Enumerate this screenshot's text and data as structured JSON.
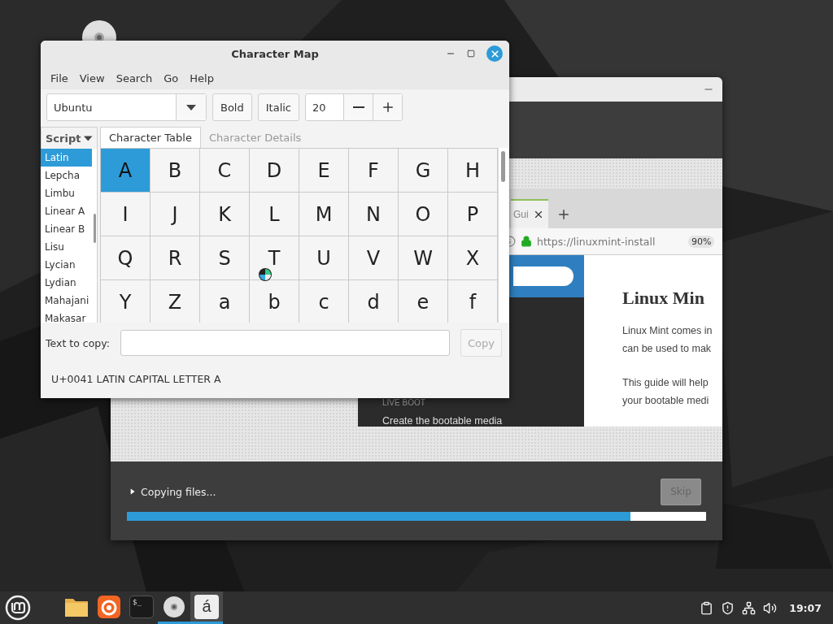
{
  "charmap": {
    "title": "Character Map",
    "menu": [
      "File",
      "View",
      "Search",
      "Go",
      "Help"
    ],
    "font": {
      "value": "Ubuntu"
    },
    "bold": {
      "label": "Bold",
      "on": false
    },
    "italic": {
      "label": "Italic",
      "on": false
    },
    "size": {
      "value": "20"
    },
    "script_button": "Script",
    "tabs": [
      {
        "label": "Character Table",
        "selected": true
      },
      {
        "label": "Character Details",
        "selected": false
      }
    ],
    "scripts": [
      {
        "label": "Latin",
        "selected": true
      },
      {
        "label": "Lepcha",
        "selected": false
      },
      {
        "label": "Limbu",
        "selected": false
      },
      {
        "label": "Linear A",
        "selected": false
      },
      {
        "label": "Linear B",
        "selected": false
      },
      {
        "label": "Lisu",
        "selected": false
      },
      {
        "label": "Lycian",
        "selected": false
      },
      {
        "label": "Lydian",
        "selected": false
      },
      {
        "label": "Mahajani",
        "selected": false
      },
      {
        "label": "Makasar",
        "selected": false
      }
    ],
    "characters": [
      {
        "char": "A",
        "selected": true
      },
      {
        "char": "B",
        "selected": false
      },
      {
        "char": "C",
        "selected": false
      },
      {
        "char": "D",
        "selected": false
      },
      {
        "char": "E",
        "selected": false
      },
      {
        "char": "F",
        "selected": false
      },
      {
        "char": "G",
        "selected": false
      },
      {
        "char": "H",
        "selected": false
      },
      {
        "char": "I",
        "selected": false
      },
      {
        "char": "J",
        "selected": false
      },
      {
        "char": "K",
        "selected": false
      },
      {
        "char": "L",
        "selected": false
      },
      {
        "char": "M",
        "selected": false
      },
      {
        "char": "N",
        "selected": false
      },
      {
        "char": "O",
        "selected": false
      },
      {
        "char": "P",
        "selected": false
      },
      {
        "char": "Q",
        "selected": false
      },
      {
        "char": "R",
        "selected": false
      },
      {
        "char": "S",
        "selected": false
      },
      {
        "char": "T",
        "selected": false
      },
      {
        "char": "U",
        "selected": false
      },
      {
        "char": "V",
        "selected": false
      },
      {
        "char": "W",
        "selected": false
      },
      {
        "char": "X",
        "selected": false
      },
      {
        "char": "Y",
        "selected": false
      },
      {
        "char": "Z",
        "selected": false
      },
      {
        "char": "a",
        "selected": false
      },
      {
        "char": "b",
        "selected": false
      },
      {
        "char": "c",
        "selected": false
      },
      {
        "char": "d",
        "selected": false
      },
      {
        "char": "e",
        "selected": false
      },
      {
        "char": "f",
        "selected": false
      }
    ],
    "copy_label": "Text to copy:",
    "copy_button": {
      "label": "Copy",
      "disabled": true
    },
    "status": "U+0041 LATIN CAPITAL LETTER A"
  },
  "installer": {
    "browser": {
      "tab": "Gui",
      "url": "https://linuxmint-install",
      "zoom": "90%",
      "sidebar": [
        "LIVE BOOT",
        "Create the bootable media"
      ],
      "heading": "Linux Min",
      "paragraphs": [
        [
          "Linux Mint comes in",
          "can be used to mak"
        ],
        [
          "This guide will help",
          "your bootable medi"
        ]
      ]
    },
    "progress": {
      "label": "Copying files...",
      "expanded": false,
      "level": 0.87
    },
    "skip": {
      "label": "Skip",
      "disabled": true
    }
  },
  "taskbar": {
    "apps": [
      {
        "kind": "folder",
        "running": false,
        "selected": false
      },
      {
        "kind": "firefox",
        "running": false,
        "selected": false
      },
      {
        "kind": "terminal",
        "glyph": "$_",
        "running": false,
        "selected": false
      },
      {
        "kind": "disc",
        "running": true,
        "selected": false
      },
      {
        "kind": "charmap",
        "glyph": "á",
        "running": true,
        "selected": true
      }
    ],
    "clock": "19:07"
  }
}
